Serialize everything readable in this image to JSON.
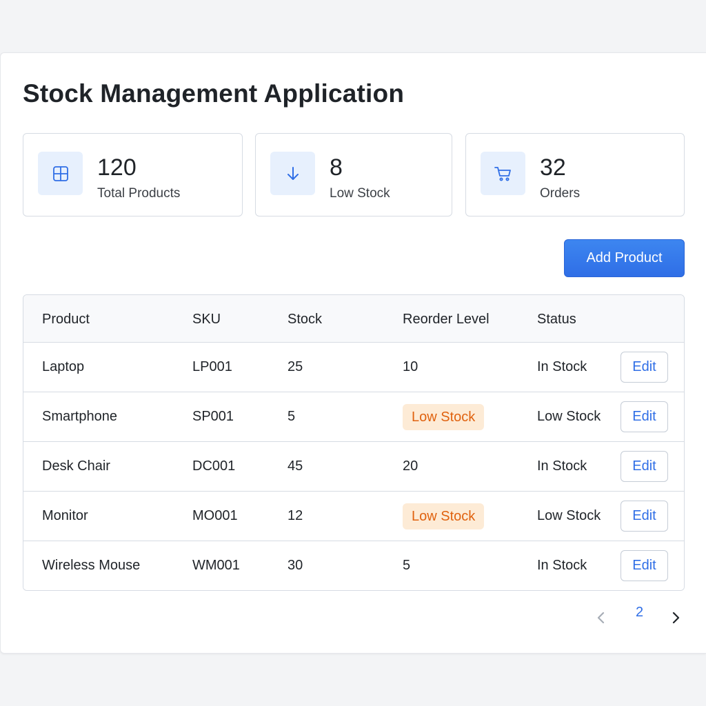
{
  "app": {
    "title": "Stock Management Application"
  },
  "stats": [
    {
      "icon": "grid-icon",
      "value": "120",
      "label": "Total Products"
    },
    {
      "icon": "arrow-down-icon",
      "value": "8",
      "label": "Low Stock"
    },
    {
      "icon": "cart-icon",
      "value": "32",
      "label": "Orders"
    }
  ],
  "toolbar": {
    "add_label": "Add Product"
  },
  "table": {
    "headers": [
      "Product",
      "SKU",
      "Stock",
      "Reorder Level",
      "Status"
    ],
    "rows": [
      {
        "product": "Laptop",
        "sku": "LP001",
        "stock": "25",
        "reorder": "10",
        "reorder_badge": false,
        "status": "In Stock",
        "edit": "Edit"
      },
      {
        "product": "Smartphone",
        "sku": "SP001",
        "stock": "5",
        "reorder": "Low Stock",
        "reorder_badge": true,
        "status": "Low Stock",
        "edit": "Edit"
      },
      {
        "product": "Desk Chair",
        "sku": "DC001",
        "stock": "45",
        "reorder": "20",
        "reorder_badge": false,
        "status": "In Stock",
        "edit": "Edit"
      },
      {
        "product": "Monitor",
        "sku": "MO001",
        "stock": "12",
        "reorder": "Low Stock",
        "reorder_badge": true,
        "status": "Low Stock",
        "edit": "Edit"
      },
      {
        "product": "Wireless Mouse",
        "sku": "WM001",
        "stock": "30",
        "reorder": "5",
        "reorder_badge": false,
        "status": "In Stock",
        "edit": "Edit"
      }
    ]
  },
  "pagination": {
    "prev": "‹",
    "current_page": "2",
    "next": "›"
  },
  "colors": {
    "accent": "#2f6ee6",
    "badge_bg": "#fdebd6",
    "badge_text": "#e0620f",
    "icon_bg": "#e7f0fd"
  }
}
